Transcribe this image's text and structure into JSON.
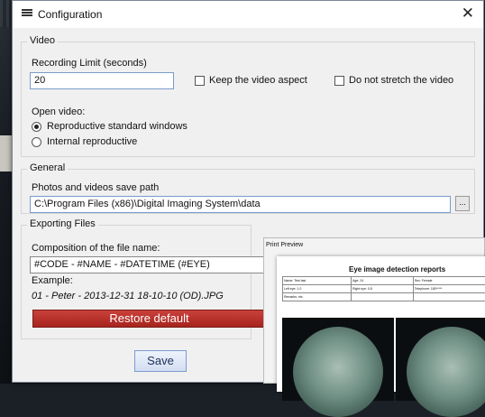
{
  "window": {
    "title": "Configuration",
    "close_glyph": "✕"
  },
  "video": {
    "group_title": "Video",
    "recording_label": "Recording Limit (seconds)",
    "recording_value": "20",
    "keep_aspect_label": "Keep the video aspect",
    "keep_aspect_checked": false,
    "no_stretch_label": "Do not stretch the video",
    "no_stretch_checked": false,
    "open_video_label": "Open video:",
    "radio_standard": "Reproductive standard windows",
    "radio_internal": "Internal reproductive",
    "selected": "standard"
  },
  "general": {
    "group_title": "General",
    "path_label": "Photos and videos save path",
    "path_value": "C:\\Program Files (x86)\\Digital Imaging System\\data",
    "browse_label": "..."
  },
  "exporting": {
    "group_title": "Exporting Files",
    "composition_label": "Composition of the file name:",
    "composition_value": "#CODE - #NAME - #DATETIME (#EYE)",
    "example_label": "Example:",
    "example_value": "01 - Peter - 2013-12-31 18-10-10 (OD).JPG",
    "restore_label": "Restore default"
  },
  "save_label": "Save",
  "print_preview": {
    "title": "Print Preview",
    "report_title": "Eye image detection reports",
    "rows": [
      [
        "Name: Test fast",
        "Age: 24",
        "Sex: Female"
      ],
      [
        "Left eye: 1.0",
        "Right eye: 0.8",
        "Telephone: 180*****"
      ],
      [
        "Remarks: etc.",
        "",
        ""
      ]
    ]
  },
  "icons": {
    "app": "window-icon",
    "close": "close-icon",
    "browse": "ellipsis-icon"
  },
  "colors": {
    "restore_bg": "#b8302a",
    "save_border": "#7d9ad1"
  }
}
